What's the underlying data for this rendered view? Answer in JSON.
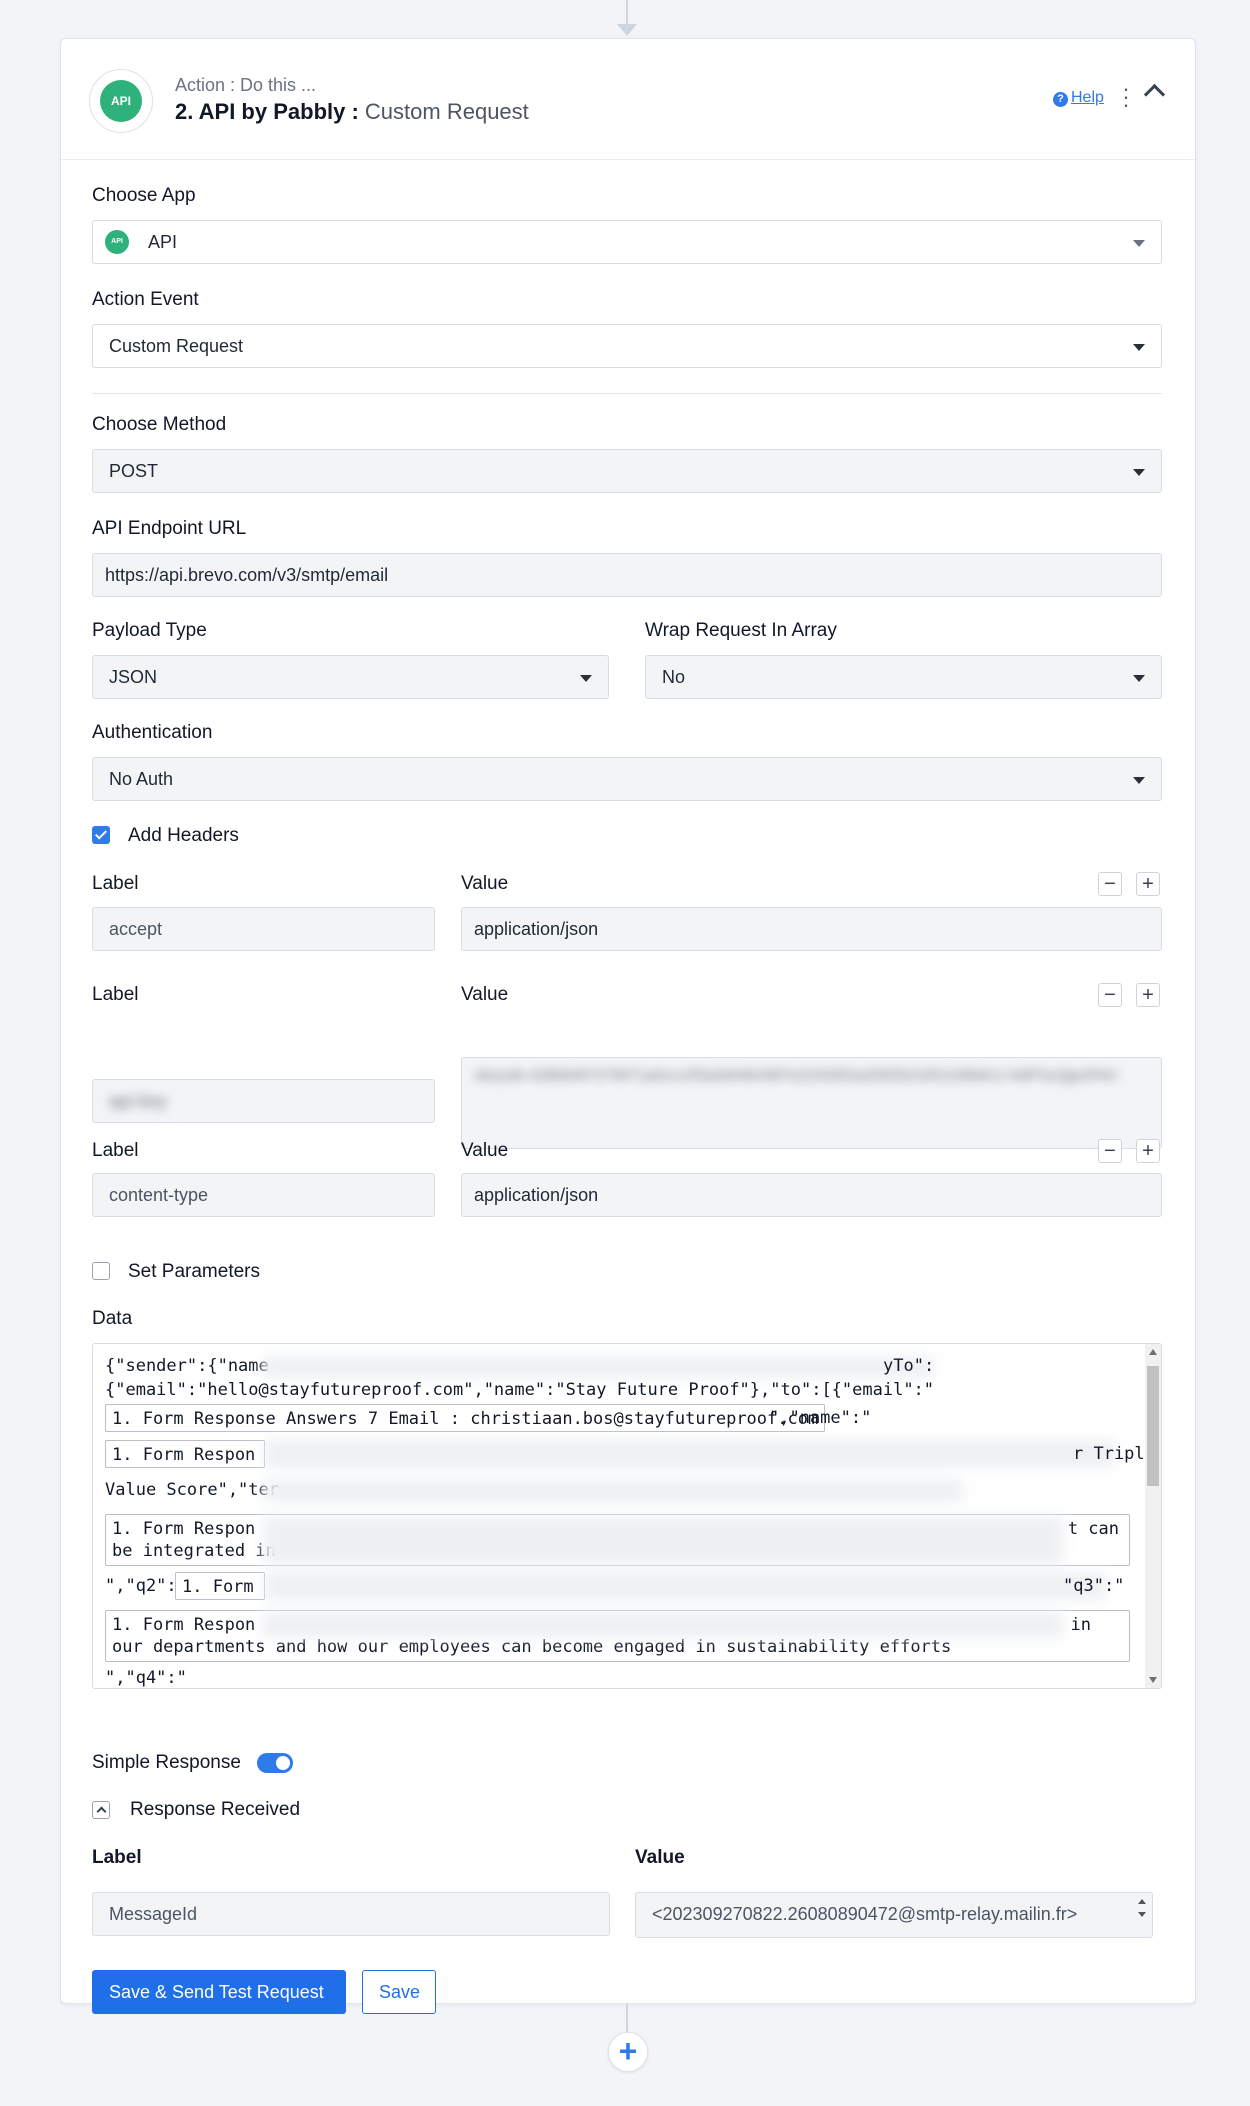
{
  "header": {
    "subtitle": "Action : Do this ...",
    "title_main": "2. API by Pabbly :",
    "title_event": "Custom Request",
    "help_label": "Help",
    "logo_text": "API"
  },
  "choose_app": {
    "label": "Choose App",
    "value": "API"
  },
  "action_event": {
    "label": "Action Event",
    "value": "Custom Request"
  },
  "choose_method": {
    "label": "Choose Method",
    "value": "POST"
  },
  "endpoint": {
    "label": "API Endpoint URL",
    "value": "https://api.brevo.com/v3/smtp/email"
  },
  "payload_type": {
    "label": "Payload Type",
    "value": "JSON"
  },
  "wrap_request": {
    "label": "Wrap Request In Array",
    "value": "No"
  },
  "authentication": {
    "label": "Authentication",
    "value": "No Auth"
  },
  "add_headers": {
    "label": "Add Headers",
    "checked": true
  },
  "headers": [
    {
      "label_title": "Label",
      "value_title": "Value",
      "label": "accept",
      "value": "application/json"
    },
    {
      "label_title": "Label",
      "value_title": "Value",
      "label": "api-key",
      "value": "xkeysib-428b8497279971a0ccc2f3a3d44b4387e2233352a2055521051156b9c1-NdPSuQjpsPAH"
    },
    {
      "label_title": "Label",
      "value_title": "Value",
      "label": "content-type",
      "value": "application/json"
    }
  ],
  "set_parameters": {
    "label": "Set Parameters",
    "checked": false
  },
  "data": {
    "label": "Data",
    "line1": "{\"sender\":{\"name",
    "line1_end": "yTo\":",
    "line2": "{\"email\":\"hello@stayfutureproof.com\",\"name\":\"Stay Future Proof\"},\"to\":[{\"email\":\"",
    "pill1": "1. Form Response Answers 7 Email : christiaan.bos@stayfutureproof.com",
    "pill1_after": "\",\"name\":\"",
    "pill2": "1. Form Respon",
    "pill2_after": "r Triple",
    "line4": "Value Score\",\"ter",
    "pill3_a": "1. Form Respon",
    "pill3_a_end": "t can",
    "pill3_b": "be integrated in",
    "line6_a": "\",\"q2\":\"",
    "pill4": "1. Form",
    "line6_b": "\"q3\":\"",
    "pill5_a": "1. Form Respon",
    "pill5_a_end": "in",
    "pill5_b": "our departments and how our employees can become engaged in sustainability efforts",
    "line8": "\",\"q4\":\""
  },
  "simple_response": {
    "label": "Simple Response",
    "enabled": true
  },
  "response_received": {
    "label": "Response Received",
    "label_title": "Label",
    "value_title": "Value",
    "field_label": "MessageId",
    "field_value": "<202309270822.26080890472@smtp-relay.mailin.fr>"
  },
  "buttons": {
    "save_send": "Save & Send Test Request",
    "save": "Save"
  },
  "add_step": "+"
}
